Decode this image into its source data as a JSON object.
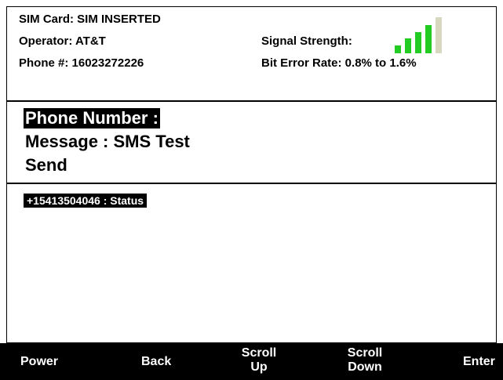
{
  "status": {
    "sim_card": "SIM Card: SIM INSERTED",
    "operator": "Operator: AT&T",
    "phone_number": "Phone #: 16023272226",
    "signal_strength_label": "Signal Strength:",
    "signal_bars_filled": 4,
    "signal_bars_total": 5,
    "signal_colors": {
      "filled": "#22cc22",
      "empty": "#d8d8c0"
    },
    "bit_error_rate": "Bit Error Rate: 0.8% to 1.6%"
  },
  "menu": {
    "phone_number": "Phone Number :",
    "message": "Message : SMS Test",
    "send": "Send"
  },
  "messages": [
    {
      "text": "+15413504046 : Status"
    }
  ],
  "softkeys": {
    "power": "Power",
    "back": "Back",
    "scroll_up_line1": "Scroll",
    "scroll_up_line2": "Up",
    "scroll_down_line1": "Scroll",
    "scroll_down_line2": "Down",
    "enter": "Enter"
  }
}
